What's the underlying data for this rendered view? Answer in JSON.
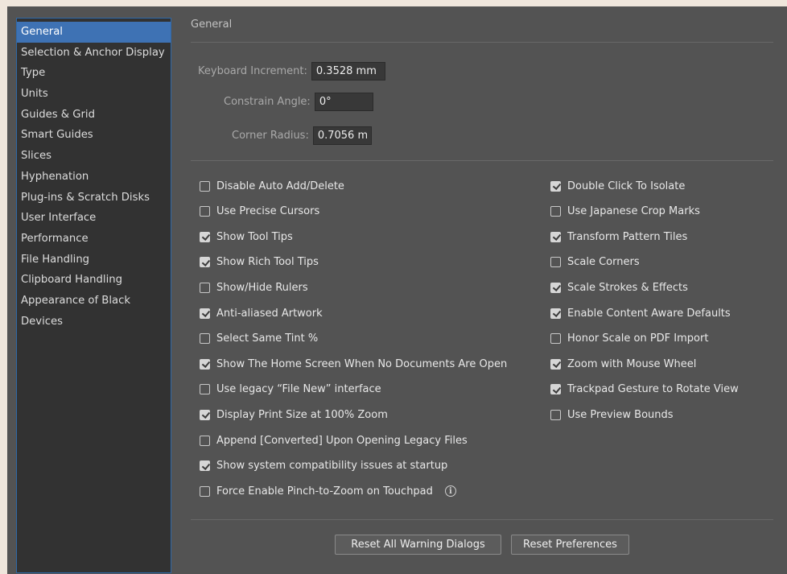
{
  "sidebar": {
    "items": [
      {
        "label": "General",
        "selected": true
      },
      {
        "label": "Selection & Anchor Display"
      },
      {
        "label": "Type"
      },
      {
        "label": "Units"
      },
      {
        "label": "Guides & Grid"
      },
      {
        "label": "Smart Guides"
      },
      {
        "label": "Slices"
      },
      {
        "label": "Hyphenation"
      },
      {
        "label": "Plug-ins & Scratch Disks"
      },
      {
        "label": "User Interface"
      },
      {
        "label": "Performance"
      },
      {
        "label": "File Handling"
      },
      {
        "label": "Clipboard Handling"
      },
      {
        "label": "Appearance of Black"
      },
      {
        "label": "Devices"
      }
    ]
  },
  "section": {
    "title": "General"
  },
  "fields": {
    "keyboard_increment": {
      "label": "Keyboard Increment:",
      "value": "0.3528 mm"
    },
    "constrain_angle": {
      "label": "Constrain Angle:",
      "value": "0°"
    },
    "corner_radius": {
      "label": "Corner Radius:",
      "value": "0.7056 mm"
    }
  },
  "options_left": [
    {
      "label": "Disable Auto Add/Delete",
      "checked": false
    },
    {
      "label": "Use Precise Cursors",
      "checked": false
    },
    {
      "label": "Show Tool Tips",
      "checked": true
    },
    {
      "label": "Show Rich Tool Tips",
      "checked": true
    },
    {
      "label": "Show/Hide Rulers",
      "checked": false
    },
    {
      "label": "Anti-aliased Artwork",
      "checked": true
    },
    {
      "label": "Select Same Tint %",
      "checked": false
    },
    {
      "label": "Show The Home Screen When No Documents Are Open",
      "checked": true
    },
    {
      "label": "Use legacy “File New” interface",
      "checked": false
    },
    {
      "label": "Display Print Size at 100% Zoom",
      "checked": true
    },
    {
      "label": "Append [Converted] Upon Opening Legacy Files",
      "checked": false
    },
    {
      "label": "Show system compatibility issues at startup",
      "checked": true
    },
    {
      "label": "Force Enable Pinch-to-Zoom on Touchpad",
      "checked": false,
      "info_icon": "info-icon",
      "info_glyph": "i"
    }
  ],
  "options_right": [
    {
      "label": "Double Click To Isolate",
      "checked": true
    },
    {
      "label": "Use Japanese Crop Marks",
      "checked": false
    },
    {
      "label": "Transform Pattern Tiles",
      "checked": true
    },
    {
      "label": "Scale Corners",
      "checked": false
    },
    {
      "label": "Scale Strokes & Effects",
      "checked": true
    },
    {
      "label": "Enable Content Aware Defaults",
      "checked": true
    },
    {
      "label": "Honor Scale on PDF Import",
      "checked": false
    },
    {
      "label": "Zoom with Mouse Wheel",
      "checked": true
    },
    {
      "label": "Trackpad Gesture to Rotate View",
      "checked": true
    },
    {
      "label": "Use Preview Bounds",
      "checked": false
    }
  ],
  "buttons": {
    "reset_warnings": "Reset All Warning Dialogs",
    "reset_prefs": "Reset Preferences"
  },
  "colors": {
    "panel": "#535353",
    "sidebar": "#323232",
    "selected": "#3e72b4",
    "accent_border": "#2f69a8"
  }
}
